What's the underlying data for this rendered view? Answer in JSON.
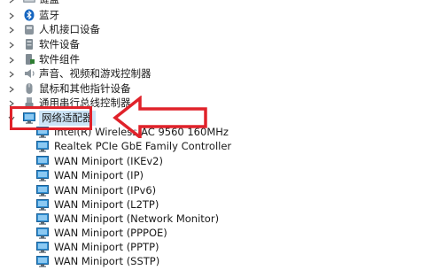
{
  "categories": [
    {
      "label": "键盘",
      "icon": "keyboard-icon"
    },
    {
      "label": "蓝牙",
      "icon": "bluetooth-icon"
    },
    {
      "label": "人机接口设备",
      "icon": "hid-icon"
    },
    {
      "label": "软件设备",
      "icon": "software-device-icon"
    },
    {
      "label": "软件组件",
      "icon": "software-component-icon"
    },
    {
      "label": "声音、视频和游戏控制器",
      "icon": "speaker-icon"
    },
    {
      "label": "鼠标和其他指针设备",
      "icon": "mouse-icon"
    },
    {
      "label": "通用串行总线控制器",
      "icon": "usb-icon"
    }
  ],
  "network_adapters": {
    "label": "网络适配器",
    "icon": "network-adapter-icon",
    "expanded": true,
    "selected": true,
    "children": [
      "Intel(R) Wireless-AC 9560 160MHz",
      "Realtek PCIe GbE Family Controller",
      "WAN Miniport (IKEv2)",
      "WAN Miniport (IP)",
      "WAN Miniport (IPv6)",
      "WAN Miniport (L2TP)",
      "WAN Miniport (Network Monitor)",
      "WAN Miniport (PPPOE)",
      "WAN Miniport (PPTP)",
      "WAN Miniport (SSTP)"
    ]
  },
  "colors": {
    "highlight": "#e0222a",
    "selection": "#cce4f7",
    "monitor_icon": "#2d8fd5"
  }
}
